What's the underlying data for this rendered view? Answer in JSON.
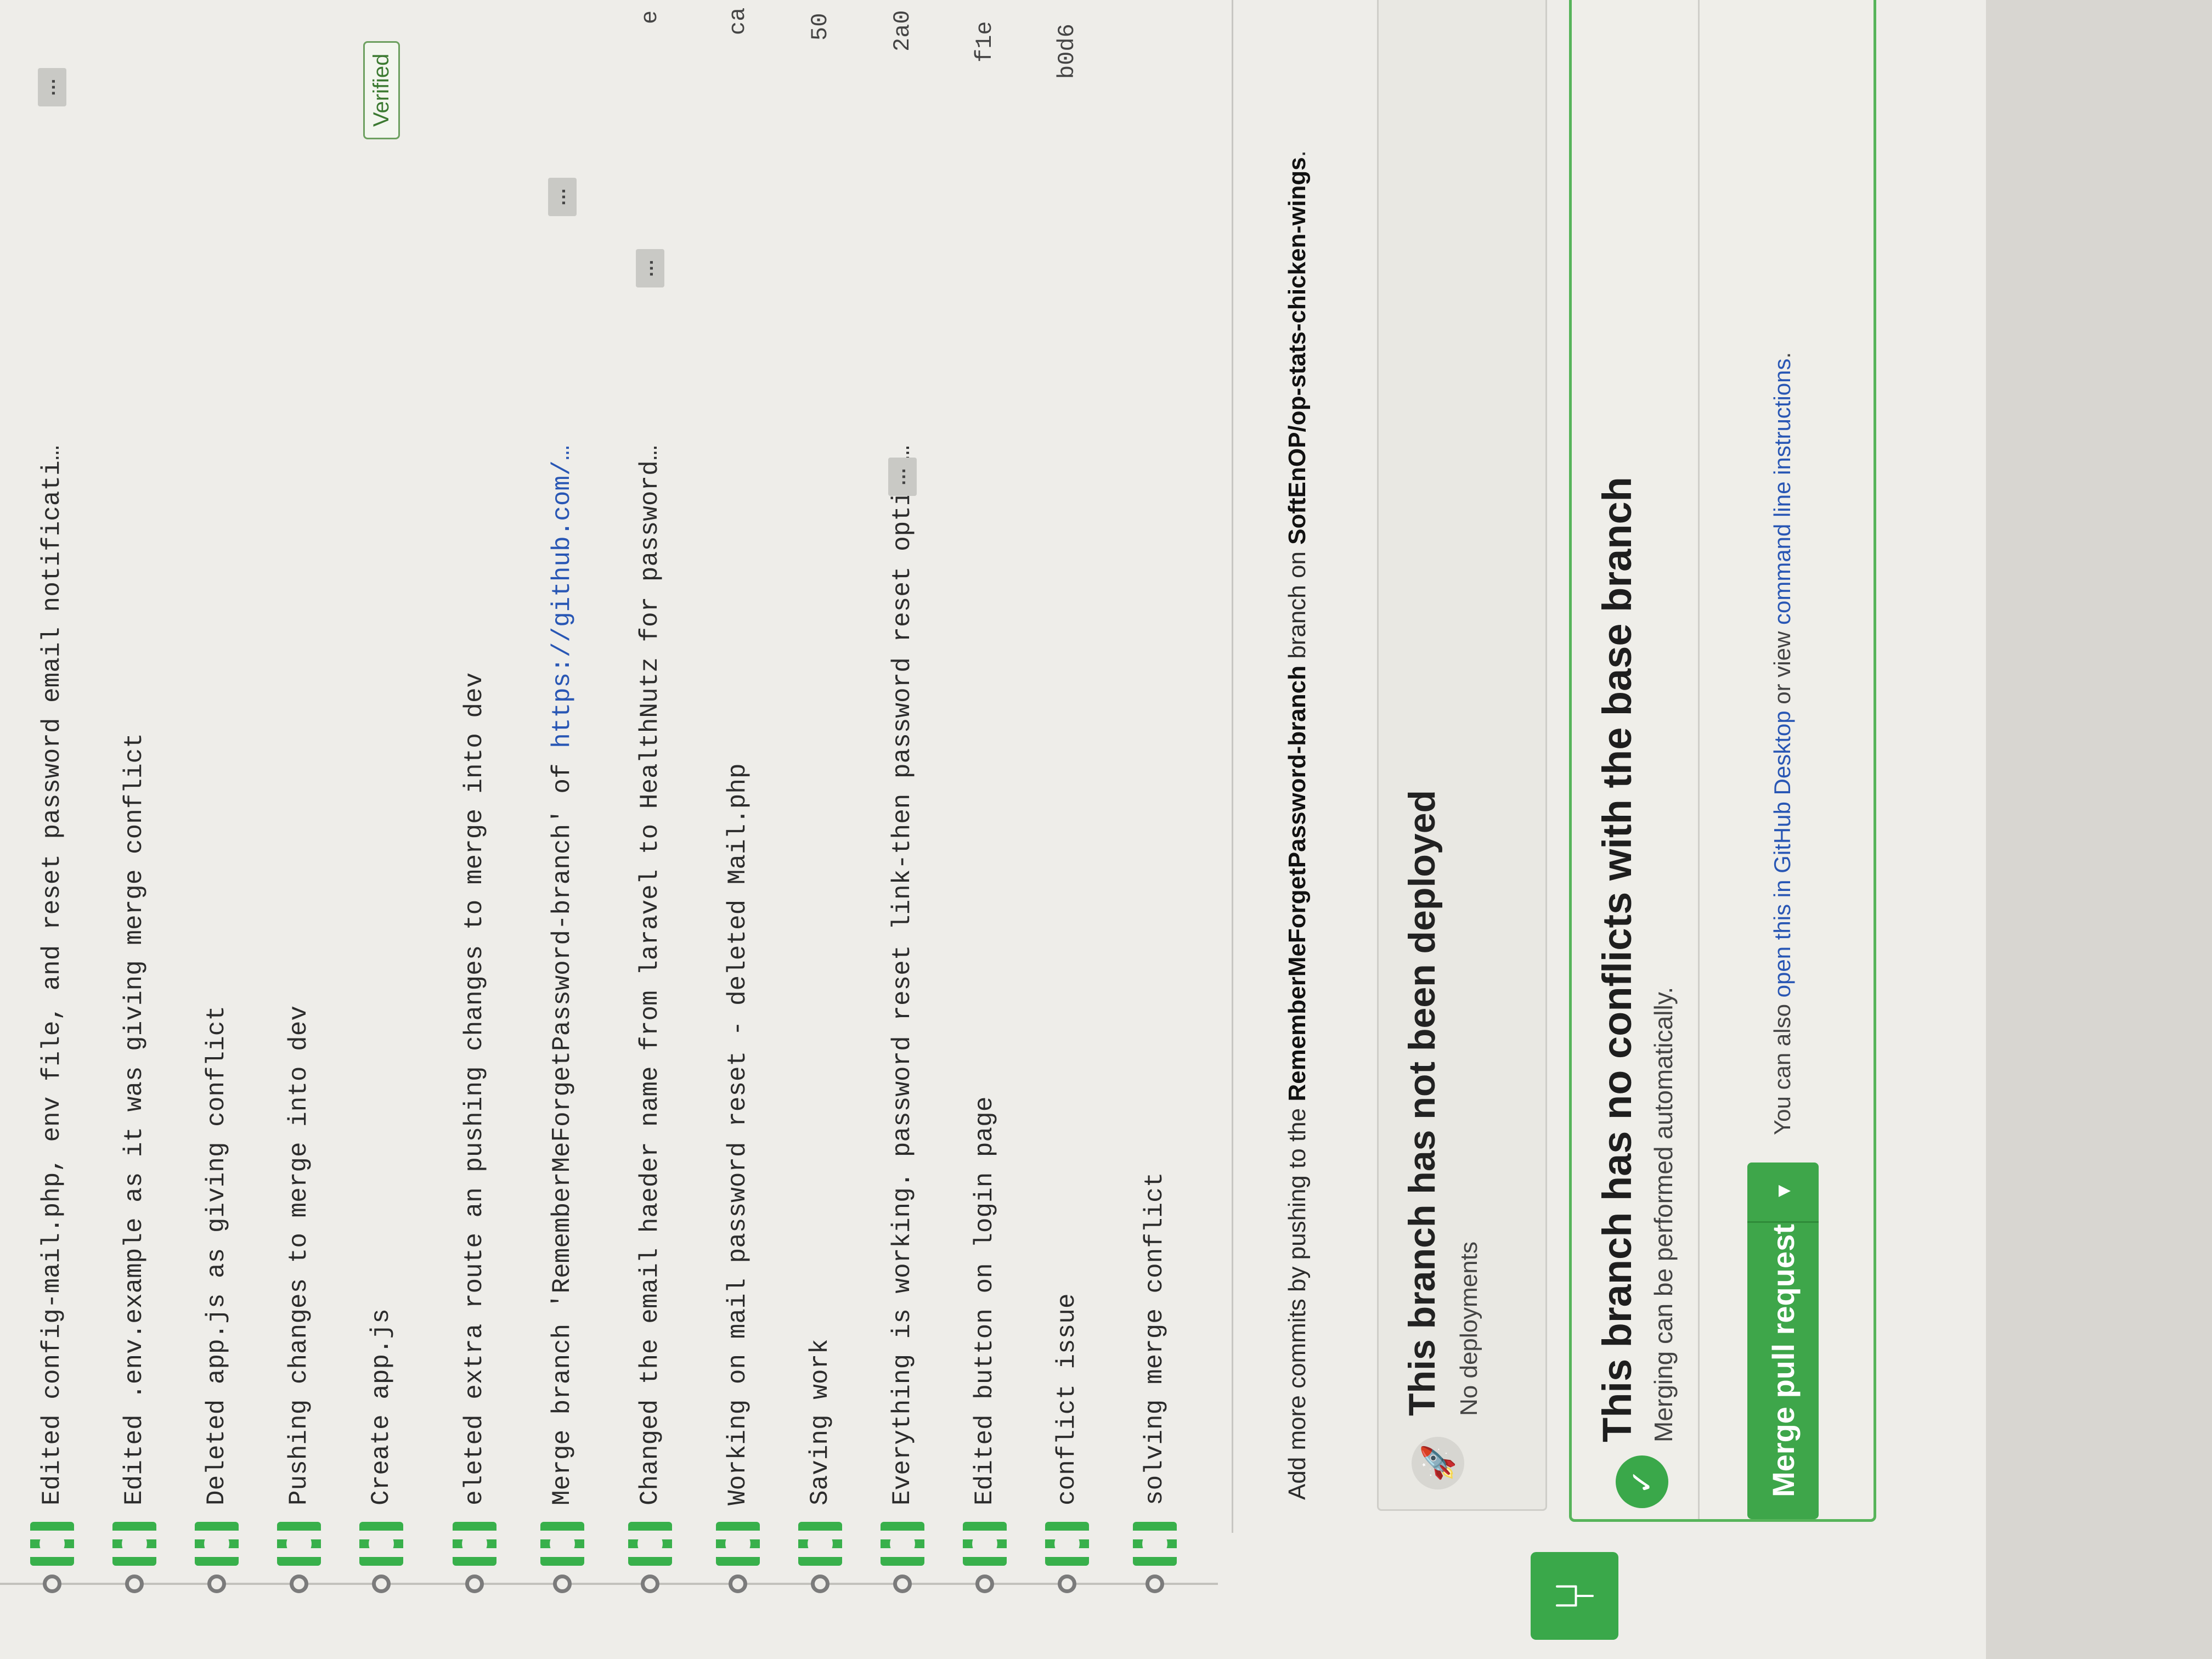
{
  "commits": [
    {
      "message": "Edited config-mail.php, env file, and reset password email notificati…",
      "has_ellipsis": true
    },
    {
      "message": "Edited .env.example as it was giving merge conflict"
    },
    {
      "message": "Deleted app.js as giving conflict"
    },
    {
      "message": "Pushing changes to merge into dev"
    },
    {
      "message": "Create app.js",
      "verified": "Verified"
    },
    {
      "message": "eleted extra route an pushing changes to merge into dev"
    },
    {
      "message_prefix": "Merge branch 'RememberMeForgetPassword-branch' of ",
      "message_link": "https://github.com/…",
      "has_ellipsis": true
    },
    {
      "message": "Changed the email haeder name from laravel to HealthNutz for password…",
      "has_ellipsis": true,
      "sha": "e"
    },
    {
      "message": "Working on mail password reset - deleted Mail.php",
      "sha": "ca"
    },
    {
      "message": "Saving work",
      "sha": "50"
    },
    {
      "message": "Everything is working. password reset link-then password reset option…",
      "has_ellipsis": true,
      "sha": "2a0"
    },
    {
      "message": "Edited button on login page",
      "sha": "f1e"
    },
    {
      "message": "conflict issue",
      "sha": "b0d6"
    },
    {
      "message": "solving merge conflict"
    }
  ],
  "add_more": {
    "prefix": "Add more commits by pushing to the ",
    "branch": "RememberMeForgetPassword-branch",
    "middle": " branch on ",
    "repo": "SoftEnOP/op-stats-chicken-wings",
    "suffix": "."
  },
  "deploy": {
    "title": "This branch has not been deployed",
    "subtitle": "No deployments",
    "icon": "rocket-icon"
  },
  "merge": {
    "title": "This branch has no conflicts with the base branch",
    "subtitle": "Merging can be performed automatically.",
    "button_label": "Merge pull request",
    "caret": "▾",
    "also_prefix": "You can also ",
    "open_link": "open this in GitHub Desktop",
    "also_middle": " or view ",
    "cli_link": "command line instructions",
    "also_suffix": "."
  },
  "colors": {
    "accent_green": "#3ea64a",
    "link_blue": "#2856b4"
  }
}
